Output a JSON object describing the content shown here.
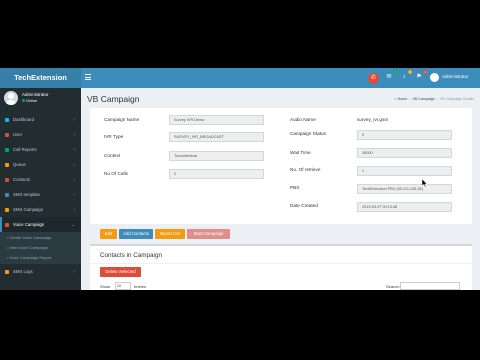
{
  "app": {
    "logo": "TechExtension"
  },
  "user": {
    "name": "Administrator",
    "status": "Online"
  },
  "header": {
    "username": "Administrator",
    "badges": [
      "1",
      "3",
      "1"
    ]
  },
  "sidebar": {
    "items": [
      {
        "label": "Dashboard",
        "color": "#00c0ef"
      },
      {
        "label": "User",
        "color": "#dd4b39"
      },
      {
        "label": "Call Reports",
        "color": "#00a65a"
      },
      {
        "label": "Queue",
        "color": "#f39c12"
      },
      {
        "label": "Contacts",
        "color": "#dd4b39"
      },
      {
        "label": "SMS template",
        "color": "#3c8dbc"
      },
      {
        "label": "SMS Campaign",
        "color": "#f39c12"
      },
      {
        "label": "Voice Campaign",
        "color": "#dd4b39"
      },
      {
        "label": "SMS Logs",
        "color": "#f39c12"
      }
    ],
    "submenu": [
      "Create Voice Campaign",
      "View Voice Campaign",
      "Voice Campaign Report"
    ]
  },
  "page": {
    "title": "VB Campaign",
    "breadcrumb": [
      "Home",
      "VB Campaign",
      "VB Campaign Details"
    ]
  },
  "details": {
    "campaign_name_label": "Campaign Name",
    "campaign_name": "Survey IVR Demo",
    "ivr_type_label": "IVR Type",
    "ivr_type": "SURVEY_IVR_BROADCAST",
    "context_label": "Context",
    "context": "Tcecontextval",
    "no_of_calls_label": "No Of Calls",
    "no_of_calls": "2",
    "audio_name_label": "Audio Name",
    "audio_name": "survey_ivr.gsm",
    "campaign_status_label": "Campaign Status",
    "campaign_status": "0",
    "wait_time_label": "Wait Time",
    "wait_time": "30000",
    "retries_label": "No. Of retrieve",
    "retries": "1",
    "pbx_label": "PBX",
    "pbx": "TechExtension PBX (80.211.228.26)",
    "date_created_label": "Date Created",
    "date_created": "2019-03-07 00:13:48"
  },
  "buttons": [
    {
      "label": "Edit",
      "color": "#f39c12"
    },
    {
      "label": "Add Contacts",
      "color": "#3c8dbc"
    },
    {
      "label": "Import Csv",
      "color": "#f39c12"
    },
    {
      "label": "Start Campaign",
      "color": "#e08e8b"
    }
  ],
  "contacts": {
    "title": "Contacts in Campaign",
    "delete_label": "Delete Selected",
    "show_label": "Show",
    "entries_value": "10",
    "entries_label": "entries",
    "search_label": "Search:"
  }
}
